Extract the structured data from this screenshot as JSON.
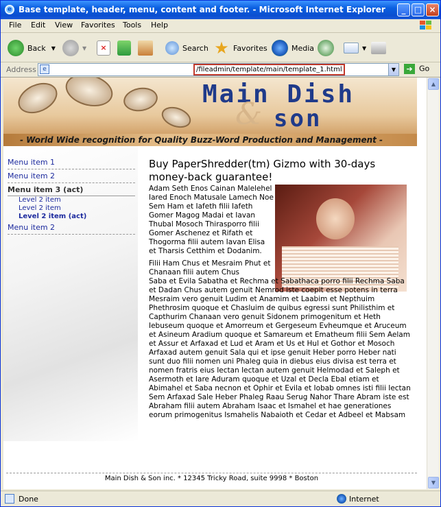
{
  "window": {
    "title": "Base template, header, menu, content and footer. - Microsoft Internet Explorer"
  },
  "menubar": [
    "File",
    "Edit",
    "View",
    "Favorites",
    "Tools",
    "Help"
  ],
  "toolbar": {
    "back": "Back",
    "search": "Search",
    "favorites": "Favorites",
    "media": "Media"
  },
  "address": {
    "label": "Address",
    "url": "/fileadmin/template/main/template_1.html",
    "go": "Go"
  },
  "banner": {
    "line1": "Main Dish",
    "amp": "&",
    "line2": "son",
    "tagline": "- World Wide recognition for Quality Buzz-Word Production and Management -"
  },
  "menu": {
    "items": [
      "Menu item 1",
      "Menu item 2"
    ],
    "active": "Menu item 3 (act)",
    "subitems": [
      "Level 2 item",
      "Level 2 item",
      "Level 2 item (act)"
    ],
    "last": "Menu item 2"
  },
  "article": {
    "heading": "Buy PaperShredder(tm) Gizmo with 30-days money-back guarantee!",
    "p1": "Adam Seth Enos Cainan Malelehel Iared Enoch Matusale Lamech Noe Sem Ham et Iafeth filii Iafeth Gomer Magog Madai et Iavan Thubal Mosoch Thirasporro filii Gomer Aschenez et Rifath et Thogorma filii autem Iavan Elisa et Tharsis Cetthim et Dodanim.",
    "p2a": "Filii Ham Chus et Mesraim Phut et Chanaan filii autem Chus",
    "p2b": "Saba et Evila Sabatha et Rechma et Sabathaca porro filii Rechma Saba et Dadan Chus autem genuit Nemrod iste coepit esse potens in terra Mesraim vero genuit Ludim et Anamim et Laabim et Nepthuim Phethrosim quoque et Chasluim de quibus egressi sunt Philisthim et Capthurim Chanaan vero genuit Sidonem primogenitum et Heth Iebuseum quoque et Amorreum et Gergeseum Evheumque et Aruceum et Asineum Aradium quoque et Samareum et Ematheum filii Sem Aelam et Assur et Arfaxad et Lud et Aram et Us et Hul et Gothor et Mosoch Arfaxad autem genuit Sala qui et ipse genuit Heber porro Heber nati sunt duo filii nomen uni Phaleg quia in diebus eius divisa est terra et nomen fratris eius Iectan Iectan autem genuit Helmodad et Saleph et Asermoth et Iare Aduram quoque et Uzal et Decla Ebal etiam et Abimahel et Saba necnon et Ophir et Evila et Iobab omnes isti filii Iectan Sem Arfaxad Sale Heber Phaleg Raau Serug Nahor Thare Abram iste est Abraham filii autem Abraham Isaac et Ismahel et hae generationes eorum primogenitus Ismahelis Nabaioth et Cedar et Adbeel et Mabsam"
  },
  "footer": "Main Dish & Son inc. * 12345 Tricky Road, suite 9998 * Boston",
  "status": {
    "left": "Done",
    "right": "Internet"
  }
}
